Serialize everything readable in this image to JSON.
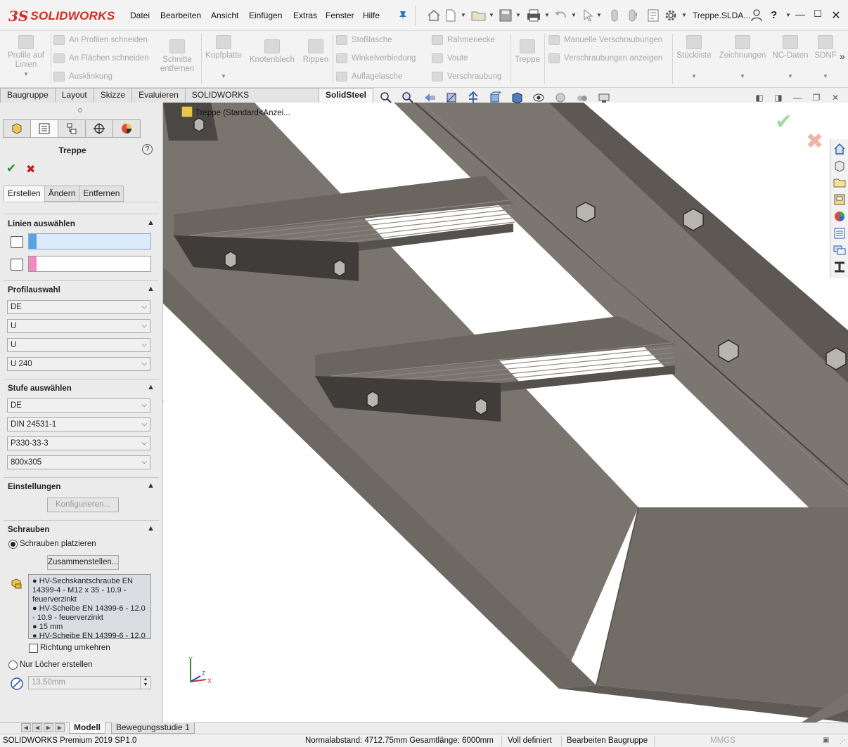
{
  "app": {
    "logo_ds": "3S",
    "logo_text": "SOLIDWORKS",
    "document_title": "Treppe.SLDA...",
    "menu": [
      "Datei",
      "Bearbeiten",
      "Ansicht",
      "Einfügen",
      "Extras",
      "Fenster",
      "Hilfe"
    ],
    "pin_icon": "pin-icon",
    "help_label": "?"
  },
  "ribbon": {
    "profile_auf_linien": "Profile auf\nLinien",
    "an_profilen_schneiden": "An Profilen schneiden",
    "an_flaechen_schneiden": "An Flächen schneiden",
    "ausklinkung": "Ausklinkung",
    "schnitte_entfernen": "Schnitte\nentfernen",
    "kopfplatte": "Kopfplatte",
    "knotenblech": "Knotenblech",
    "rippen": "Rippen",
    "stosslasche": "Stoßlasche",
    "winkelverbindung": "Winkelverbindung",
    "auflagelasche": "Auflagelasche",
    "rahmenecke": "Rahmenecke",
    "voute": "Voute",
    "verschraubung": "Verschraubung",
    "treppe": "Treppe",
    "manuelle_verschraubungen": "Manuelle Verschraubungen",
    "verschraubungen_anzeigen": "Verschraubungen anzeigen",
    "stueckliste": "Stückliste",
    "zeichnungen": "Zeichnungen",
    "nc_daten": "NC-Daten",
    "sdnf": "SDNF",
    "more": "»"
  },
  "tabs": [
    {
      "label": "Baugruppe"
    },
    {
      "label": "Layout"
    },
    {
      "label": "Skizze"
    },
    {
      "label": "Evaluieren"
    },
    {
      "label": "SOLIDWORKS Zusatzanwendungen"
    },
    {
      "label": "SolidSteel",
      "active": true
    }
  ],
  "property_manager": {
    "title": "Treppe",
    "help": "?",
    "ok": "✔",
    "cancel": "✖",
    "tabs": [
      "Erstellen",
      "Ändern",
      "Entfernen"
    ],
    "linien": {
      "title": "Linien auswählen",
      "color1": "#5ba3e0",
      "color2": "#f28bc2"
    },
    "profilauswahl": {
      "title": "Profilauswahl",
      "values": [
        "DE",
        "U",
        "U",
        "U 240"
      ]
    },
    "stufe": {
      "title": "Stufe auswählen",
      "values": [
        "DE",
        "DIN 24531-1",
        "P330-33-3",
        "800x305"
      ]
    },
    "einstellungen": {
      "title": "Einstellungen",
      "button": "Konfigurieren..."
    },
    "schrauben": {
      "title": "Schrauben",
      "radio_place": "Schrauben platzieren",
      "assemble_button": "Zusammenstellen...",
      "list": [
        "● HV-Sechskantschraube EN 14399-4 - M12 x 35 - 10.9 - feuerverzinkt",
        "● HV-Scheibe EN 14399-6 - 12.0 - 10.9 - feuerverzinkt",
        "● 15 mm",
        "● HV-Scheibe EN 14399-6 - 12.0"
      ],
      "reverse_direction": "Richtung umkehren",
      "radio_holes": "Nur Löcher erstellen",
      "diameter": "13.50mm"
    }
  },
  "viewport": {
    "tree_label": "Treppe  (Standard<Anzei...",
    "accept_color": "#9fdca6",
    "reject_color": "#f2b3a8",
    "triad_labels": [
      "Y",
      "X",
      "Z"
    ]
  },
  "bottom_tabs": [
    "Modell",
    "Bewegungsstudie 1"
  ],
  "status": {
    "product": "SOLIDWORKS Premium 2019 SP1.0",
    "normal_distance": "Normalabstand: 4712.75mm Gesamtlänge: 6000mm",
    "defined": "Voll definiert",
    "editing": "Bearbeiten Baugruppe",
    "units": "MMGS"
  }
}
